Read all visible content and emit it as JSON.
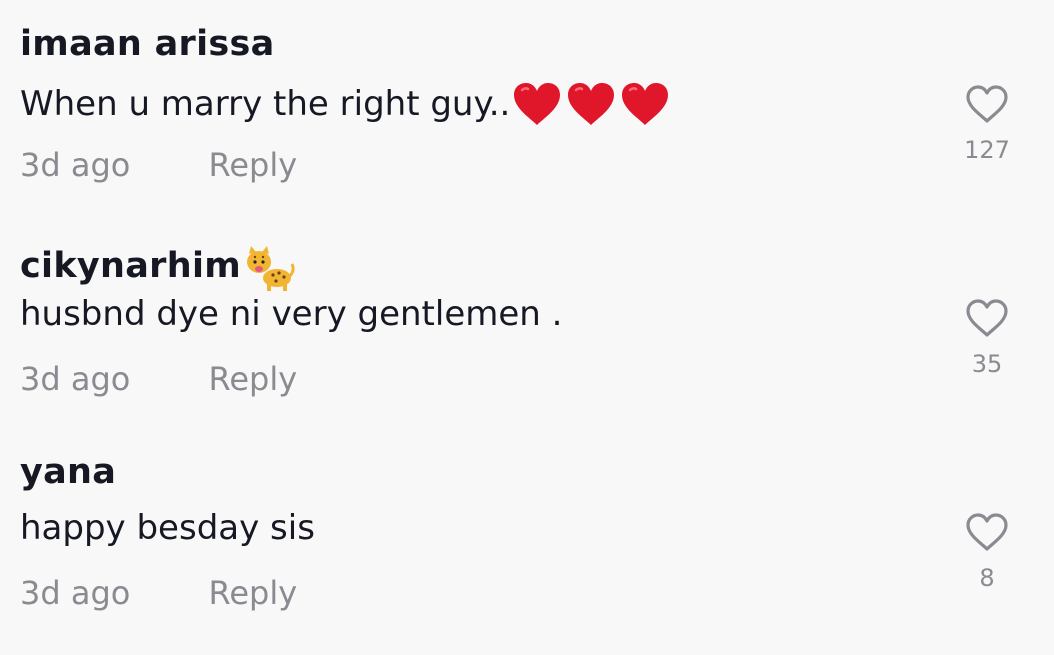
{
  "comments": [
    {
      "username": "imaan arissa",
      "text": "When u marry the right guy..",
      "text_emoji": "red-heart-icon x3",
      "time": "3d ago",
      "reply_label": "Reply",
      "like_count": "127"
    },
    {
      "username": "cikynarhim",
      "username_emoji": "leopard-icon",
      "text": "husbnd dye ni very gentlemen .",
      "time": "3d ago",
      "reply_label": "Reply",
      "like_count": "35"
    },
    {
      "username": "yana",
      "text": "happy besday sis",
      "time": "3d ago",
      "reply_label": "Reply",
      "like_count": "8"
    }
  ],
  "colors": {
    "background": "#f8f8f8",
    "primary_text": "#161823",
    "secondary_text": "#8a8b91",
    "heart_emoji": "#e0162b"
  }
}
